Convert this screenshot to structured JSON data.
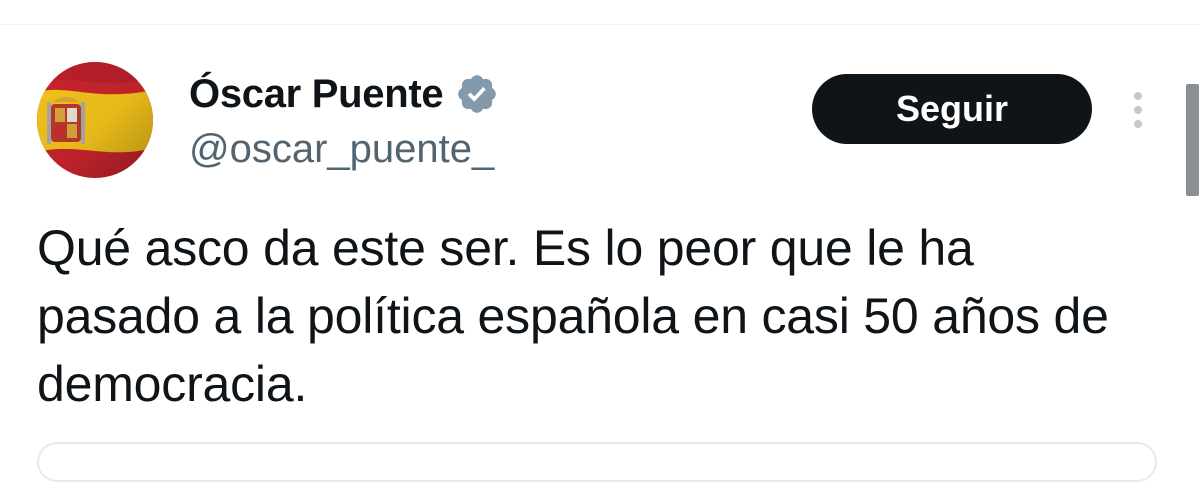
{
  "tweet": {
    "author": {
      "display_name": "Óscar Puente",
      "handle": "@oscar_puente_",
      "verified": true,
      "avatar": "spanish-flag-avatar"
    },
    "follow_label": "Seguir",
    "more_icon": "more-vertical-icon",
    "text": "Qué asco da este ser. Es lo peor que le ha pasado a la política española en casi 50 años de democracia."
  },
  "colors": {
    "text_primary": "#0f1419",
    "text_secondary": "#536471",
    "button_bg": "#0f1419",
    "button_text": "#ffffff",
    "verified_badge": "#829aab",
    "divider": "#eff3f4"
  }
}
